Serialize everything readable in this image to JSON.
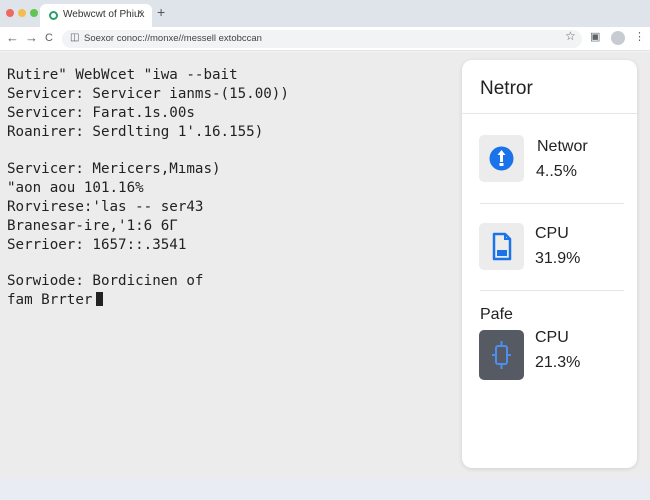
{
  "browser": {
    "tab_title": "Webwcwt of Phiux",
    "tab_close": "×",
    "new_tab": "+",
    "back": "←",
    "forward": "→",
    "reload": "C",
    "url": "Soexor conoc://monxe//messell extobccan",
    "colors": {
      "close": "#ee6a5f",
      "minimize": "#f5bd4f",
      "maximize": "#61c454"
    }
  },
  "terminal": {
    "lines": [
      "Rutire\" WebWcet \"iwa --bait",
      "Servicer: Servicer ianms-(15.00))",
      "Servicer: Farat.1s.00s",
      "Roanirer: Serdlting 1'.16.155)",
      "Servicer: Mericers,Mımas)",
      "\"aon aou 101.16%",
      "Rorvirese:'las -- ser43",
      "Branesar-ire,'1:6 6Γ",
      "Serrioer: 1657::.3541",
      "Sorwiode: Bordicinen of",
      "fam Brrter"
    ]
  },
  "panel": {
    "title": "Netror",
    "cards": [
      {
        "label": "Networ",
        "value": "4..5%",
        "icon": "network-icon",
        "accent": "#1a73e8"
      },
      {
        "label": "CPU",
        "value": "31.9%",
        "icon": "document-icon",
        "accent": "#1a73e8"
      },
      {
        "label": "CPU",
        "value": "21.3%",
        "icon": "device-icon",
        "accent": "#4d8ff0"
      }
    ],
    "section_label": "Pafe"
  }
}
